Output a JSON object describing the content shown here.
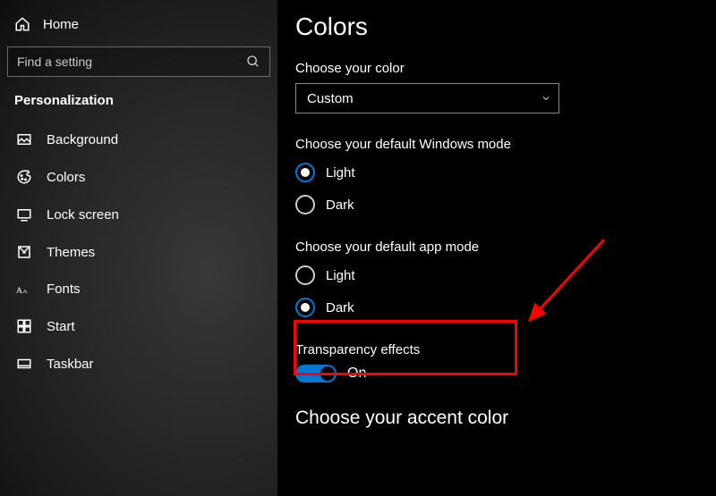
{
  "sidebar": {
    "home_label": "Home",
    "search_placeholder": "Find a setting",
    "section_title": "Personalization",
    "items": [
      {
        "label": "Background"
      },
      {
        "label": "Colors"
      },
      {
        "label": "Lock screen"
      },
      {
        "label": "Themes"
      },
      {
        "label": "Fonts"
      },
      {
        "label": "Start"
      },
      {
        "label": "Taskbar"
      }
    ]
  },
  "main": {
    "page_title": "Colors",
    "choose_color_label": "Choose your color",
    "color_dropdown_value": "Custom",
    "windows_mode": {
      "label": "Choose your default Windows mode",
      "options": [
        {
          "label": "Light",
          "selected": true
        },
        {
          "label": "Dark",
          "selected": false
        }
      ]
    },
    "app_mode": {
      "label": "Choose your default app mode",
      "options": [
        {
          "label": "Light",
          "selected": false
        },
        {
          "label": "Dark",
          "selected": true
        }
      ]
    },
    "transparency": {
      "label": "Transparency effects",
      "state_text": "On",
      "on": true
    },
    "accent_heading": "Choose your accent color"
  }
}
